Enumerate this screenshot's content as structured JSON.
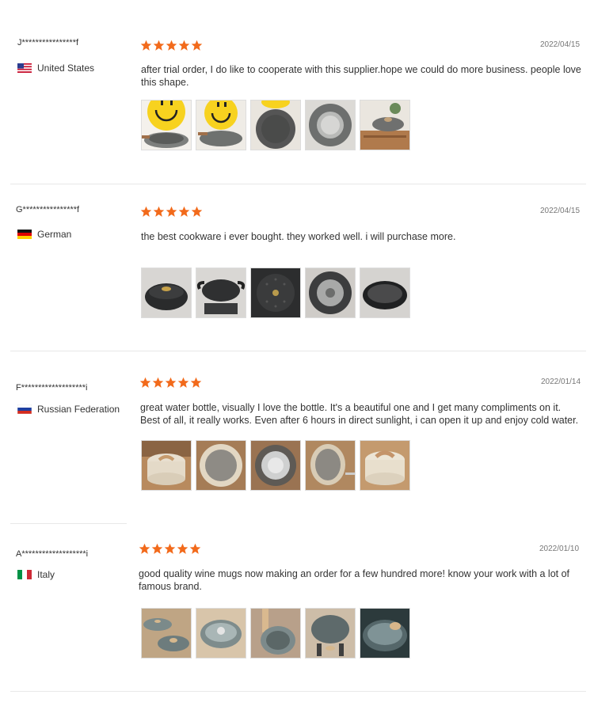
{
  "reviews": [
    {
      "user": "J****************f",
      "country": "United States",
      "flag": "us-flag-icon",
      "rating": 5,
      "date": "2022/04/15",
      "text": "after trial order, I do like to cooperate with this supplier.hope we could do more business. people love this shape.",
      "photos": [
        "smiley-pan-photo",
        "smiley-pan-lid-photo",
        "pan-interior-photo",
        "pan-bottom-photo",
        "pot-on-stand-photo"
      ]
    },
    {
      "user": "G****************f",
      "country": "German",
      "flag": "de-flag-icon",
      "rating": 5,
      "date": "2022/04/15",
      "text": "the best cookware i ever bought. they worked well. i will purchase more.",
      "photos": [
        "black-casserole-photo",
        "casserole-handles-photo",
        "lid-detail-photo",
        "pot-base-photo",
        "granite-pan-photo"
      ]
    },
    {
      "user": "F*******************i",
      "country": "Russian Federation",
      "flag": "ru-flag-icon",
      "rating": 5,
      "date": "2022/01/14",
      "text": "great water bottle, visually I love the bottle. It's a beautiful one and I get many compliments on it. Best of all, it really works. Even after 6 hours in direct sunlight, i can open it up and enjoy cold water.",
      "photos": [
        "cream-pot-photo",
        "pot-interior-photo",
        "pot-bottom-photo",
        "pot-side-photo",
        "cream-pot-lid-photo"
      ]
    },
    {
      "user": "A*******************i",
      "country": "Italy",
      "flag": "it-flag-icon",
      "rating": 5,
      "date": "2022/01/10",
      "text": "good quality wine mugs now making an order for a few hundred more! know your work with a lot of famous brand.",
      "photos": [
        "pot-set-photo",
        "glass-lid-pot-photo",
        "milk-pan-photo",
        "pot-stand-photo",
        "glass-lid-photo"
      ]
    }
  ],
  "colors": {
    "star": "#f26a1b",
    "separator": "#e8e8e8"
  }
}
